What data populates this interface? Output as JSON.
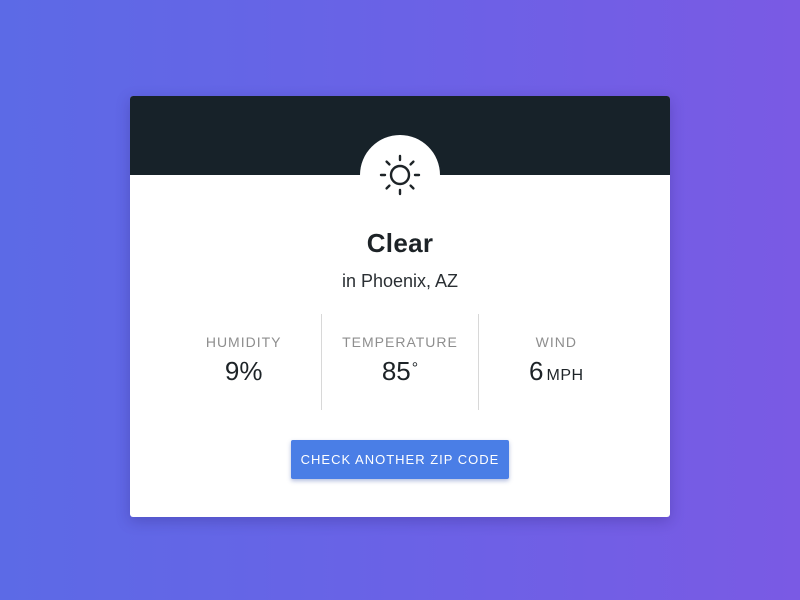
{
  "weather": {
    "condition": "Clear",
    "location": "in Phoenix, AZ",
    "icon": "sun-icon"
  },
  "stats": [
    {
      "label": "Humidity",
      "value": "9%",
      "sup": "",
      "unit": ""
    },
    {
      "label": "Temperature",
      "value": "85",
      "sup": "°",
      "unit": ""
    },
    {
      "label": "Wind",
      "value": "6",
      "sup": "",
      "unit": "MPH"
    }
  ],
  "actions": {
    "check_zip_label": "Check another zip code"
  },
  "colors": {
    "header_bg": "#172229",
    "button_bg": "#4a7ee6",
    "gradient_start": "#5c6ae6",
    "gradient_end": "#7a5ae4"
  }
}
